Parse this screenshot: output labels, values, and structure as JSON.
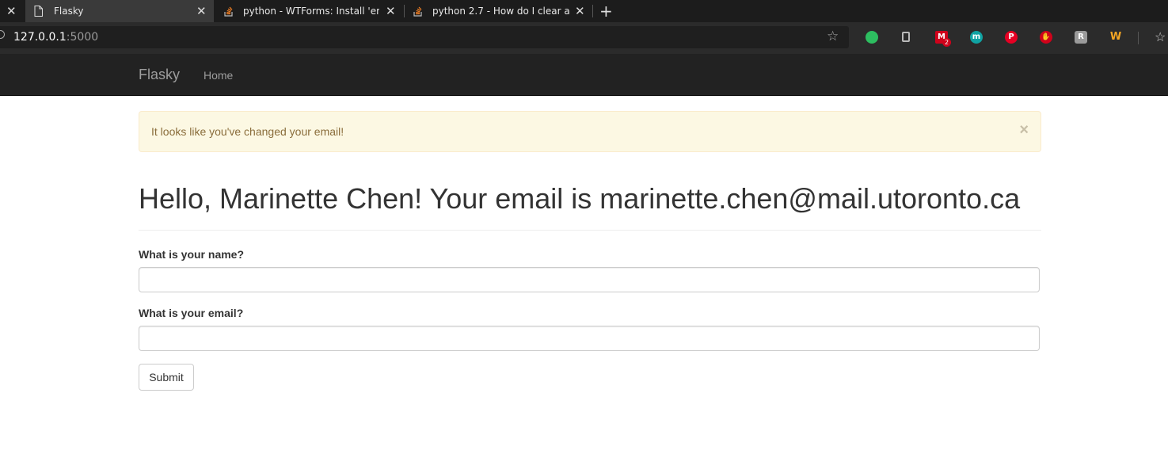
{
  "browser": {
    "tabs": [
      {
        "title": "Flasky",
        "icon": "page-icon",
        "active": true
      },
      {
        "title": "python - WTForms: Install 'email",
        "icon": "stackoverflow-icon",
        "active": false
      },
      {
        "title": "python 2.7 - How do I clear a flas",
        "icon": "stackoverflow-icon",
        "active": false
      }
    ],
    "url_host": "127.0.0.1",
    "url_port": ":5000",
    "extensions": [
      {
        "name": "evernote-icon",
        "color": "#2dbe60",
        "glyph": "🐘"
      },
      {
        "name": "office-icon",
        "color": "#8a8a8a",
        "glyph": "▮"
      },
      {
        "name": "gmail-icon",
        "color": "#d0021b",
        "glyph": "M",
        "badge": "2"
      },
      {
        "name": "m-icon",
        "color": "#10a3a3",
        "glyph": "m"
      },
      {
        "name": "pinterest-icon",
        "color": "#e60023",
        "glyph": "P"
      },
      {
        "name": "hand-icon",
        "color": "#d0021b",
        "glyph": "✋"
      },
      {
        "name": "r-icon",
        "color": "#9a9a9a",
        "glyph": "R"
      },
      {
        "name": "w-icon",
        "color": "#f5a623",
        "glyph": "W"
      }
    ]
  },
  "navbar": {
    "brand": "Flasky",
    "links": [
      "Home"
    ]
  },
  "alert": {
    "message": "It looks like you've changed your email!",
    "close": "×"
  },
  "main": {
    "title": "Hello, Marinette Chen! Your email is marinette.chen@mail.utoronto.ca",
    "form": {
      "name_label": "What is your name?",
      "name_value": "",
      "email_label": "What is your email?",
      "email_value": "",
      "submit_label": "Submit"
    }
  }
}
